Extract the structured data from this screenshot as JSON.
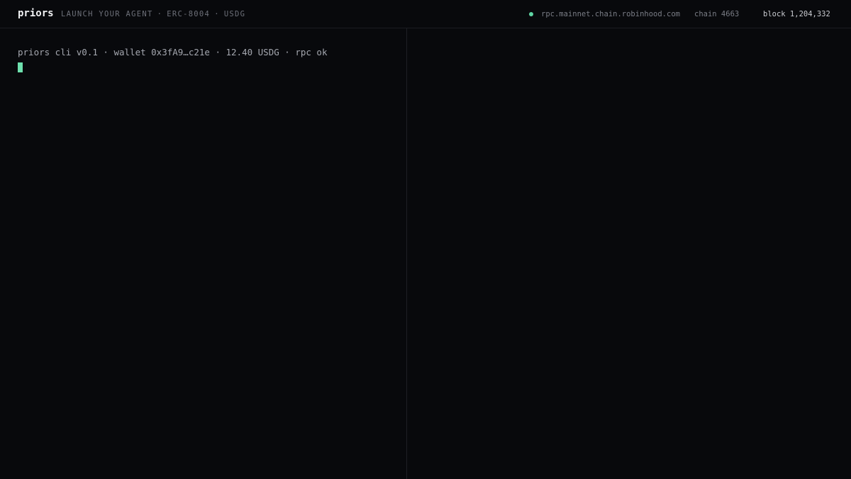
{
  "header": {
    "brand": "priors",
    "tagline": {
      "launch": "LAUNCH YOUR AGENT",
      "sep1": "·",
      "standard": "ERC-8004",
      "sep2": "·",
      "token": "USDG"
    },
    "rpc_status_color": "#5fd6a4",
    "rpc_host": "rpc.mainnet.chain.robinhood.com",
    "chain": "chain 4663",
    "block": "block 1,204,332"
  },
  "terminal": {
    "status_line": "priors cli v0.1 · wallet 0x3fA9…c21e · 12.40 USDG · rpc ok",
    "cursor_color": "#6ee0ae"
  }
}
